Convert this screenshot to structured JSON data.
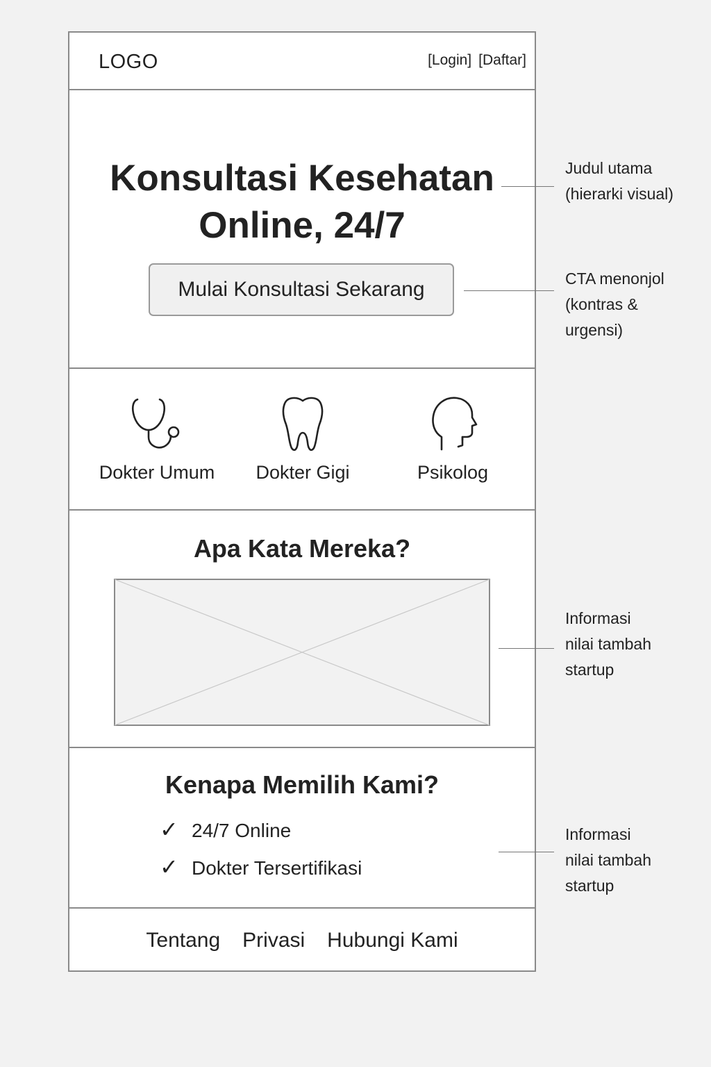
{
  "header": {
    "logo": "LOGO",
    "login": "[Login]",
    "register": "[Daftar]"
  },
  "hero": {
    "title_line1": "Konsultasi Kesehatan",
    "title_line2": "Online, 24/7",
    "cta_label": "Mulai Konsultasi Sekarang"
  },
  "services": [
    {
      "label": "Dokter Umum",
      "icon": "stethoscope-icon"
    },
    {
      "label": "Dokter Gigi",
      "icon": "tooth-icon"
    },
    {
      "label": "Psikolog",
      "icon": "head-icon"
    }
  ],
  "testimonials": {
    "heading": "Apa Kata Mereka?"
  },
  "why": {
    "heading": "Kenapa Memilih Kami?",
    "items": [
      "24/7 Online",
      "Dokter Tersertifikasi"
    ],
    "check_symbol": "✓"
  },
  "footer": {
    "links": [
      "Tentang",
      "Privasi",
      "Hubungi Kami"
    ]
  },
  "annotations": [
    {
      "lines": [
        "Judul utama",
        "(hierarki visual)"
      ]
    },
    {
      "lines": [
        "CTA menonjol",
        "(kontras &",
        "urgensi)"
      ]
    },
    {
      "lines": [
        "Informasi",
        "nilai tambah",
        "startup"
      ]
    },
    {
      "lines": [
        "Informasi",
        "nilai tambah",
        "startup"
      ]
    }
  ]
}
